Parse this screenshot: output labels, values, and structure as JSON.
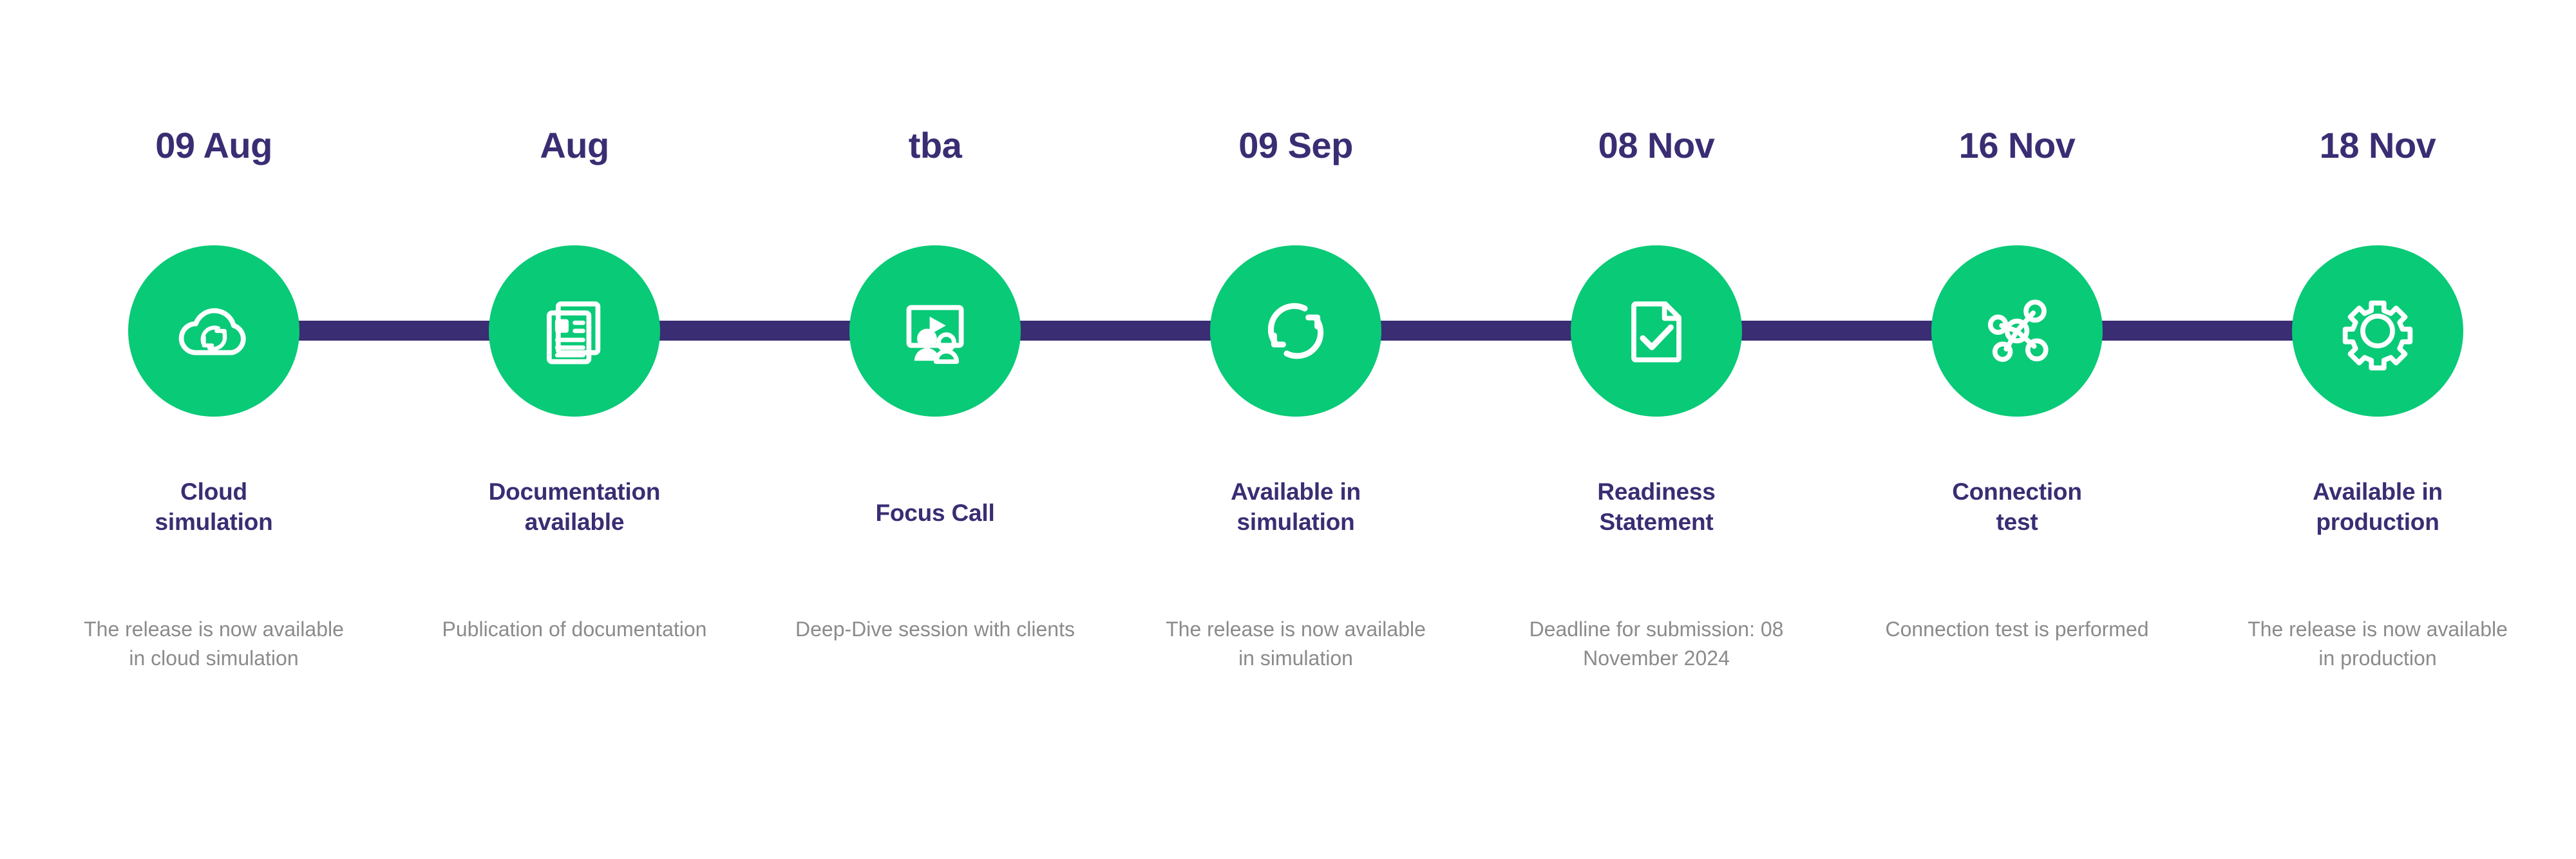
{
  "theme": {
    "accent_green": "#09ca77",
    "accent_purple": "#3a2d73",
    "description_gray": "#8b8b8b",
    "background": "#ffffff"
  },
  "timeline": {
    "orientation": "horizontal",
    "milestone_count": 7,
    "milestones": [
      {
        "date": "09 Aug",
        "title_line1": "Cloud",
        "title_line2": "simulation",
        "description": "The release is now available in cloud simulation",
        "icon": "cloud-sync-icon"
      },
      {
        "date": "Aug",
        "title_line1": "Documentation",
        "title_line2": "available",
        "description": "Publication of documentation",
        "icon": "documents-icon"
      },
      {
        "date": "tba",
        "title_line1": "Focus Call",
        "title_line2": "",
        "description": "Deep-Dive session with clients",
        "icon": "presentation-people-icon"
      },
      {
        "date": "09 Sep",
        "title_line1": "Available in",
        "title_line2": "simulation",
        "description": "The release is now available in simulation",
        "icon": "refresh-sync-icon"
      },
      {
        "date": "08 Nov",
        "title_line1": "Readiness",
        "title_line2": "Statement",
        "description": "Deadline for submission: 08 November 2024",
        "icon": "document-check-icon"
      },
      {
        "date": "16 Nov",
        "title_line1": "Connection",
        "title_line2": "test",
        "description": "Connection test is performed",
        "icon": "network-nodes-icon"
      },
      {
        "date": "18 Nov",
        "title_line1": "Available in",
        "title_line2": "production",
        "description": "The release is now available in production",
        "icon": "gear-icon"
      }
    ]
  }
}
